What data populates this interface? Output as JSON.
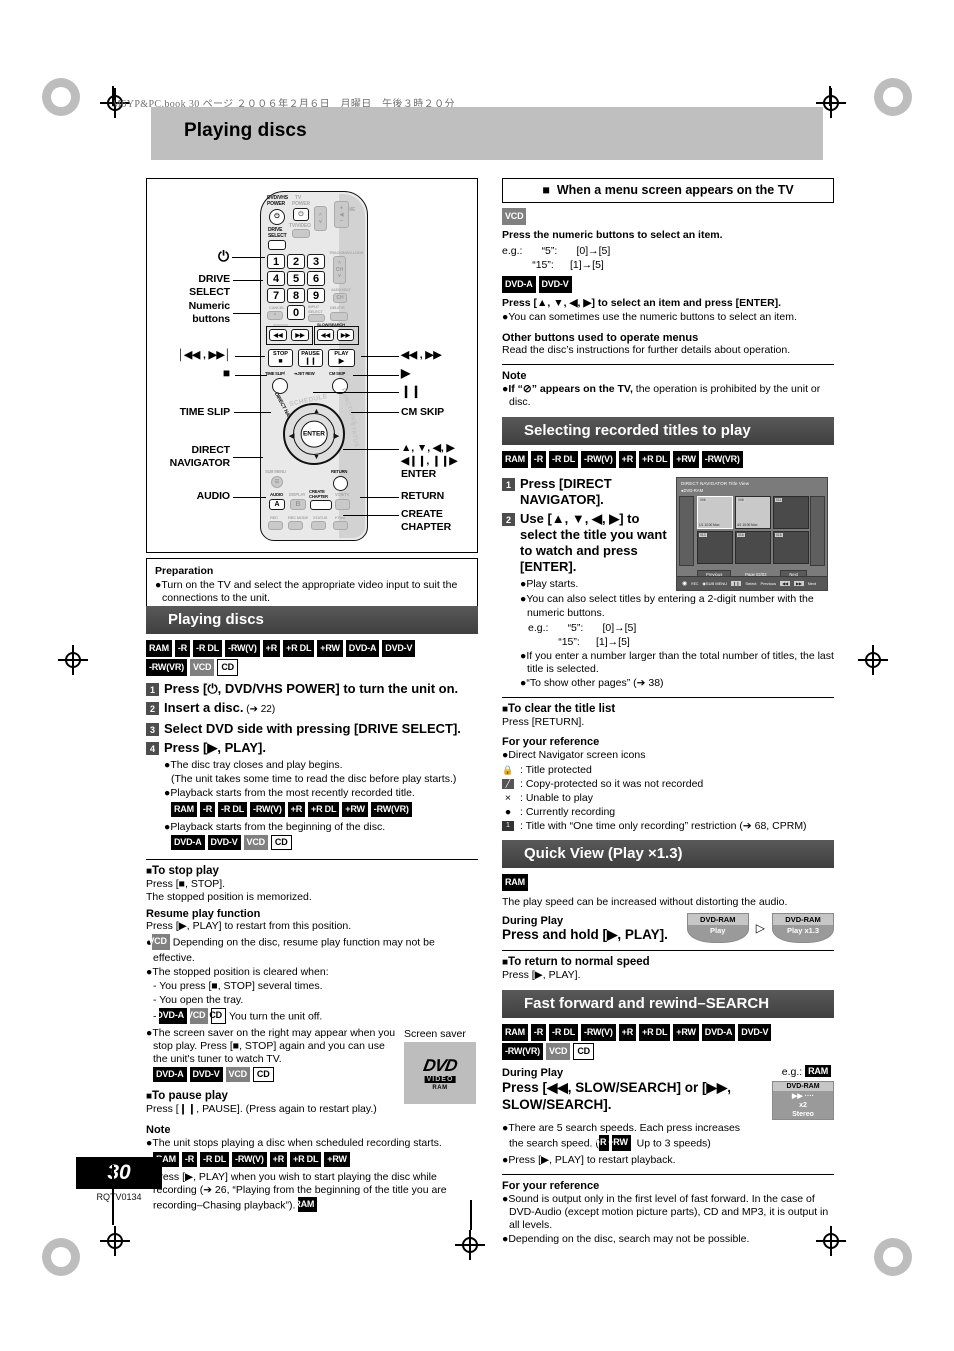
{
  "meta": {
    "running_header": "M6YP&PC.book  30 ページ  ２００６年２月６日　月曜日　午後３時２０分",
    "page_title": "Playing discs",
    "page_number": "30",
    "doc_code": "RQTV0134"
  },
  "remote": {
    "labels_left": [
      {
        "name": "power",
        "text": "⏻"
      },
      {
        "name": "drive-select",
        "text": "DRIVE\nSELECT"
      },
      {
        "name": "numeric-buttons",
        "text": "Numeric\nbuttons"
      },
      {
        "name": "skip",
        "text": "│◀◀ , ▶▶│"
      },
      {
        "name": "stop",
        "text": "■"
      },
      {
        "name": "time-slip",
        "text": "TIME SLIP"
      },
      {
        "name": "direct-navigator",
        "text": "DIRECT\nNAVIGATOR"
      },
      {
        "name": "audio",
        "text": "AUDIO"
      }
    ],
    "labels_right": [
      {
        "name": "search",
        "text": "◀◀ , ▶▶"
      },
      {
        "name": "play",
        "text": "▶"
      },
      {
        "name": "pause",
        "text": "❙❙"
      },
      {
        "name": "cm-skip",
        "text": "CM SKIP"
      },
      {
        "name": "cursor",
        "text": "▲, ▼, ◀, ▶"
      },
      {
        "name": "slow",
        "text": "◀❙❙, ❙❙▶"
      },
      {
        "name": "enter",
        "text": "ENTER"
      },
      {
        "name": "return",
        "text": "RETURN"
      },
      {
        "name": "create-chapter",
        "text": "CREATE\nCHAPTER"
      }
    ],
    "face": {
      "dvd_vhs_power": "DVD/VHS\nPOWER",
      "drive_select": "DRIVE\nSELECT",
      "tv": "TV",
      "tv_power": "POWER",
      "tv_video": "TV/VIDEO",
      "ch": "CH",
      "volume": "VOLUME",
      "tracking": "TRACKING/V-LOCK",
      "audio_out": "AUDIO/DLT",
      "cancel": "CANCEL",
      "input_select": "INPUT\nSELECT",
      "delete": "DELETE",
      "numbers": [
        "1",
        "2",
        "3",
        "4",
        "5",
        "6",
        "7",
        "8",
        "9",
        "0"
      ],
      "slow_search": "SLOW/SEARCH",
      "stop": "STOP",
      "pause": "PAUSE",
      "play": "PLAY",
      "time_slip": "TIME SLIP/",
      "jet_rew": "JET REW",
      "cm_skip": "CM SKIP",
      "schedule": "SCHEDULE",
      "functions": "FUNCTIONS",
      "direct_navigator": "DIRECT NAVIGATOR",
      "status": "STATUS",
      "enter": "ENTER",
      "sub_menu": "SUB MENU",
      "return": "RETURN",
      "audio": "AUDIO",
      "a": "A",
      "display": "DISPLAY",
      "b": "B",
      "create_chapter": "CREATE\nCHAPTER",
      "vcr_tv": "VCR/TV",
      "rec": "REC",
      "rec_mode": "REC MODE",
      "f_rec": "F Rec"
    }
  },
  "preparation": {
    "heading": "Preparation",
    "bullet": "Turn on the TV and select the appropriate video input to suit the connections to the unit."
  },
  "playing_discs": {
    "heading": "Playing discs",
    "tags": [
      {
        "label": "RAM",
        "style": "blk"
      },
      {
        "label": "-R",
        "style": "blk"
      },
      {
        "label": "-R DL",
        "style": "blk"
      },
      {
        "label": "-RW(V)",
        "style": "blk"
      },
      {
        "label": "+R",
        "style": "blk"
      },
      {
        "label": "+R DL",
        "style": "blk"
      },
      {
        "label": "+RW",
        "style": "blk"
      },
      {
        "label": "DVD-A",
        "style": "blk"
      },
      {
        "label": "DVD-V",
        "style": "blk"
      },
      {
        "label": "-RW(VR)",
        "style": "blk"
      },
      {
        "label": "VCD",
        "style": "gry"
      },
      {
        "label": "CD",
        "style": "wht"
      }
    ],
    "steps": [
      {
        "num": "1",
        "text": "Press [⏻, DVD/VHS POWER] to turn the unit on.",
        "suffix": ""
      },
      {
        "num": "2",
        "text": "Insert a disc.",
        "suffix": " (➔ 22)"
      },
      {
        "num": "3",
        "text": "Select DVD side with pressing [DRIVE SELECT].",
        "suffix": ""
      },
      {
        "num": "4",
        "text": "Press [▶, PLAY].",
        "suffix": ""
      }
    ],
    "bullets": [
      "The disc tray closes and play begins.",
      "(The unit takes some time to read the disc before play starts.)",
      "Playback starts from the most recently recorded title.",
      "Playback starts from the beginning of the disc."
    ],
    "tags_recent": [
      {
        "label": "RAM",
        "style": "blk"
      },
      {
        "label": "-R",
        "style": "blk"
      },
      {
        "label": "-R DL",
        "style": "blk"
      },
      {
        "label": "-RW(V)",
        "style": "blk"
      },
      {
        "label": "+R",
        "style": "blk"
      },
      {
        "label": "+R DL",
        "style": "blk"
      },
      {
        "label": "+RW",
        "style": "blk"
      },
      {
        "label": "-RW(VR)",
        "style": "blk"
      }
    ],
    "tags_beginning": [
      {
        "label": "DVD-A",
        "style": "blk"
      },
      {
        "label": "DVD-V",
        "style": "blk"
      },
      {
        "label": "VCD",
        "style": "gry"
      },
      {
        "label": "CD",
        "style": "wht"
      }
    ]
  },
  "stop_play": {
    "heading": "To stop play",
    "line1": "Press [■, STOP].",
    "line2": "The stopped position is memorized.",
    "resume_head": "Resume play function",
    "resume_line": "Press [▶, PLAY] to restart from this position.",
    "vcd_bullet": "Depending on the disc, resume play function may not be effective.",
    "cleared_head": "The stopped position is cleared when:",
    "cleared_items": [
      "- You press [■, STOP] several times.",
      "- You open the tray.",
      "- "
    ],
    "cleared_last": "You turn the unit off.",
    "saver_bullet": "The screen saver on the right may appear when you stop play. Press [■, STOP] again and you can use the unit's tuner to watch TV.",
    "saver_label": "Screen saver",
    "saver_logo": {
      "dvd": "DVD",
      "video": "VIDEO",
      "ram": "RAM"
    },
    "tags_clear": [
      {
        "label": "DVD-A",
        "style": "blk"
      },
      {
        "label": "VCD",
        "style": "gry"
      },
      {
        "label": "CD",
        "style": "wht"
      }
    ],
    "tags_saver": [
      {
        "label": "DVD-A",
        "style": "blk"
      },
      {
        "label": "DVD-V",
        "style": "blk"
      },
      {
        "label": "VCD",
        "style": "gry"
      },
      {
        "label": "CD",
        "style": "wht"
      }
    ]
  },
  "pause_play": {
    "heading": "To pause play",
    "line": "Press [❙❙, PAUSE]. (Press again to restart play.)"
  },
  "note_left": {
    "heading": "Note",
    "b1": "The unit stops playing a disc when scheduled recording starts.",
    "b1_tags": [
      {
        "label": "RAM",
        "style": "blk"
      },
      {
        "label": "-R",
        "style": "blk"
      },
      {
        "label": "-R DL",
        "style": "blk"
      },
      {
        "label": "-RW(V)",
        "style": "blk"
      },
      {
        "label": "+R",
        "style": "blk"
      },
      {
        "label": "+R DL",
        "style": "blk"
      },
      {
        "label": "+RW",
        "style": "blk"
      }
    ],
    "b2": "Press [▶, PLAY] when you wish to start playing the disc while recording (➔ 26, “Playing from the beginning of the title you are recording–Chasing playback”).",
    "b2_tags": [
      {
        "label": "RAM",
        "style": "blk"
      }
    ]
  },
  "menu_screen": {
    "heading": "When a menu screen appears on the TV",
    "tags_vcd": [
      {
        "label": "VCD",
        "style": "gry"
      }
    ],
    "vcd_line": "Press the numeric buttons to select an item.",
    "eg_label": "e.g.:",
    "eg_rows": [
      {
        "q": "“5”:",
        "seq": "[0]→[5]"
      },
      {
        "q": "“15”:",
        "seq": "[1]→[5]"
      }
    ],
    "tags_dvd": [
      {
        "label": "DVD-A",
        "style": "blk"
      },
      {
        "label": "DVD-V",
        "style": "blk"
      }
    ],
    "dvd_line": "Press [▲, ▼, ◀, ▶] to select an item and press [ENTER].",
    "dvd_bullet": "You can sometimes use the numeric buttons to select an item.",
    "other_head": "Other buttons used to operate menus",
    "other_line": "Read the disc’s instructions for further details about operation.",
    "note_head": "Note",
    "note_bold": "If “⊘” appears on the TV,",
    "note_rest": " the operation is prohibited by the unit or disc."
  },
  "selecting_titles": {
    "heading": "Selecting recorded titles to play",
    "tags": [
      {
        "label": "RAM",
        "style": "blk"
      },
      {
        "label": "-R",
        "style": "blk"
      },
      {
        "label": "-R DL",
        "style": "blk"
      },
      {
        "label": "-RW(V)",
        "style": "blk"
      },
      {
        "label": "+R",
        "style": "blk"
      },
      {
        "label": "+R DL",
        "style": "blk"
      },
      {
        "label": "+RW",
        "style": "blk"
      },
      {
        "label": "-RW(VR)",
        "style": "blk"
      }
    ],
    "steps": [
      {
        "num": "1",
        "text": "Press [DIRECT NAVIGATOR]."
      },
      {
        "num": "2",
        "text": "Use [▲, ▼, ◀, ▶] to select the title you want to watch and press [ENTER]."
      }
    ],
    "bullets": [
      "Play starts.",
      "You can also select titles by entering a 2-digit number with the numeric buttons."
    ],
    "eg_label": "e.g.:",
    "eg_rows": [
      {
        "q": "“5”:",
        "seq": "[0]→[5]"
      },
      {
        "q": "“15”:",
        "seq": "[1]→[5]"
      }
    ],
    "bullets2": [
      "If you enter a number larger than the total number of titles, the last title is selected.",
      "“To show other pages” (➔ 38)"
    ],
    "screenshot": {
      "title": "DIRECT NAVIGATOR  Title View",
      "subtitle": "DVD-RAM",
      "cells": [
        {
          "no": "006",
          "cap": "1/1  10:00 Mon"
        },
        {
          "no": "008",
          "cap": "4/1  10:00 Mon"
        },
        {
          "no": "011",
          "cap": ""
        },
        {
          "no": "013",
          "cap": ""
        },
        {
          "no": "016",
          "cap": ""
        },
        {
          "no": "018",
          "cap": ""
        }
      ],
      "previous": "Previous",
      "page": "Page 02/02",
      "next": "Next",
      "bottom": {
        "rec": "REC",
        "sub_menu": "SUB MENU",
        "select_key": "❙❙",
        "select": "Select",
        "previous": "Previous",
        "prev_key": "◀◀",
        "next_key": "▶▶",
        "next": "Next"
      }
    }
  },
  "clear_title_list": {
    "heading": "To clear the title list",
    "line": "Press [RETURN].",
    "ref_head": "For your reference",
    "ref_bullet": "Direct Navigator screen icons",
    "icons": [
      {
        "glyph": "lock-icon",
        "label": "Title protected"
      },
      {
        "glyph": "copy-protect-icon",
        "label": "Copy-protected so it was not recorded"
      },
      {
        "glyph": "x-icon",
        "label": "Unable to play"
      },
      {
        "glyph": "record-dot-icon",
        "label": "Currently recording"
      },
      {
        "glyph": "one-time-icon",
        "label": "Title with “One time only recording” restriction (➔ 68, CPRM)"
      }
    ]
  },
  "quick_view": {
    "heading": "Quick View (Play ×1.3)",
    "tags": [
      {
        "label": "RAM",
        "style": "blk"
      }
    ],
    "line": "The play speed can be increased without distorting the audio.",
    "during_play": "During Play",
    "action": "Press and hold [▶, PLAY].",
    "osd_left": {
      "top": "DVD-RAM",
      "bot": "Play"
    },
    "osd_right": {
      "top": "DVD-RAM",
      "bot": "Play x1.3"
    },
    "return_head": "To return to normal speed",
    "return_line": "Press [▶, PLAY]."
  },
  "search": {
    "heading": "Fast forward and rewind–SEARCH",
    "tags": [
      {
        "label": "RAM",
        "style": "blk"
      },
      {
        "label": "-R",
        "style": "blk"
      },
      {
        "label": "-R DL",
        "style": "blk"
      },
      {
        "label": "-RW(V)",
        "style": "blk"
      },
      {
        "label": "+R",
        "style": "blk"
      },
      {
        "label": "+R DL",
        "style": "blk"
      },
      {
        "label": "+RW",
        "style": "blk"
      },
      {
        "label": "DVD-A",
        "style": "blk"
      },
      {
        "label": "DVD-V",
        "style": "blk"
      },
      {
        "label": "-RW(VR)",
        "style": "blk"
      },
      {
        "label": "VCD",
        "style": "gry"
      },
      {
        "label": "CD",
        "style": "wht"
      }
    ],
    "during_play": "During Play",
    "action": "Press [◀◀, SLOW/SEARCH] or [▶▶, SLOW/SEARCH].",
    "eg_label": "e.g.:",
    "eg_tags": [
      {
        "label": "RAM",
        "style": "blk"
      }
    ],
    "osd": {
      "r1": "DVD-RAM",
      "r2": "▶▶ ····",
      "r3": "x2",
      "r4": "Stereo"
    },
    "bullets": [
      "There are 5 search speeds. Each press increases the search speed. (",
      "Press [▶, PLAY] to restart playback."
    ],
    "bullet_tags": [
      {
        "label": "+R",
        "style": "blk"
      },
      {
        "label": "+RW",
        "style": "blk"
      }
    ],
    "bullet_tail": " Up to 3 speeds)",
    "ref_head": "For your reference",
    "ref_bullets": [
      "Sound is output only in the first level of fast forward. In the case of DVD-Audio (except motion picture parts), CD and MP3, it is output in all levels.",
      "Depending on the disc, search may not be possible."
    ]
  }
}
